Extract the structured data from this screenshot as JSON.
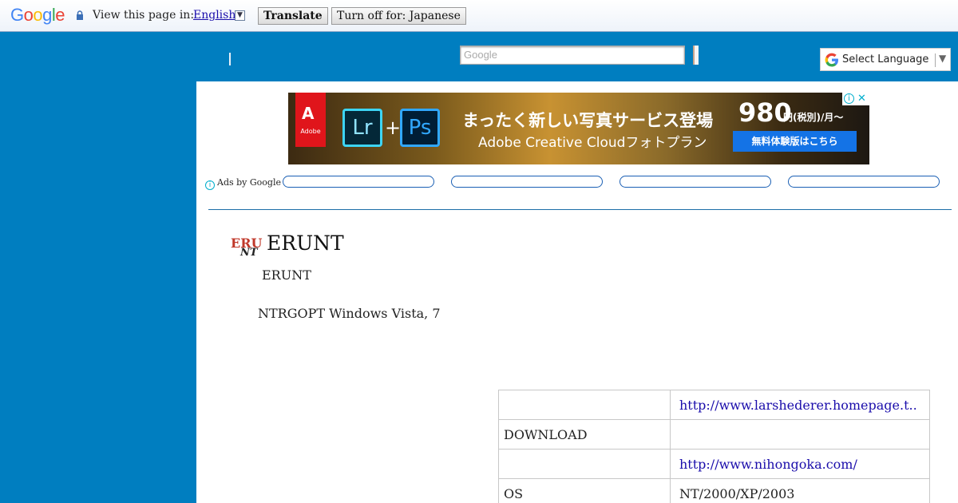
{
  "translate_bar": {
    "logo_text": "Google",
    "view_text": "View this page in:",
    "language": "English",
    "translate_button": "Translate",
    "turn_off_button": "Turn off for: Japanese"
  },
  "header": {
    "search_placeholder": "Google",
    "language_select": "Select Language",
    "language_arrow": "▼"
  },
  "ad": {
    "brand": "Adobe",
    "brand_mark": "A",
    "app1": "Lr",
    "app2": "Ps",
    "plus": "+",
    "headline": "まったく新しい写真サービス登場",
    "subline": "Adobe Creative Cloudフォトプラン",
    "price": "980",
    "price_unit": "円(税別)/月〜",
    "cta": "無料体験版はこちら",
    "ads_by": "Ads by Google"
  },
  "content": {
    "logo_top": "ERU",
    "logo_bottom": "NT",
    "title": "ERUNT",
    "subtitle": "ERUNT",
    "description": "NTRGOPT  Windows Vista, 7"
  },
  "info_table": [
    {
      "label": "",
      "value": "http://www.larshederer.homepage.t..",
      "link": true
    },
    {
      "label": "DOWNLOAD",
      "value": "",
      "link": false
    },
    {
      "label": "",
      "value": "http://www.nihongoka.com/",
      "link": true
    },
    {
      "label": "OS",
      "value": "NT/2000/XP/2003",
      "link": false
    }
  ]
}
